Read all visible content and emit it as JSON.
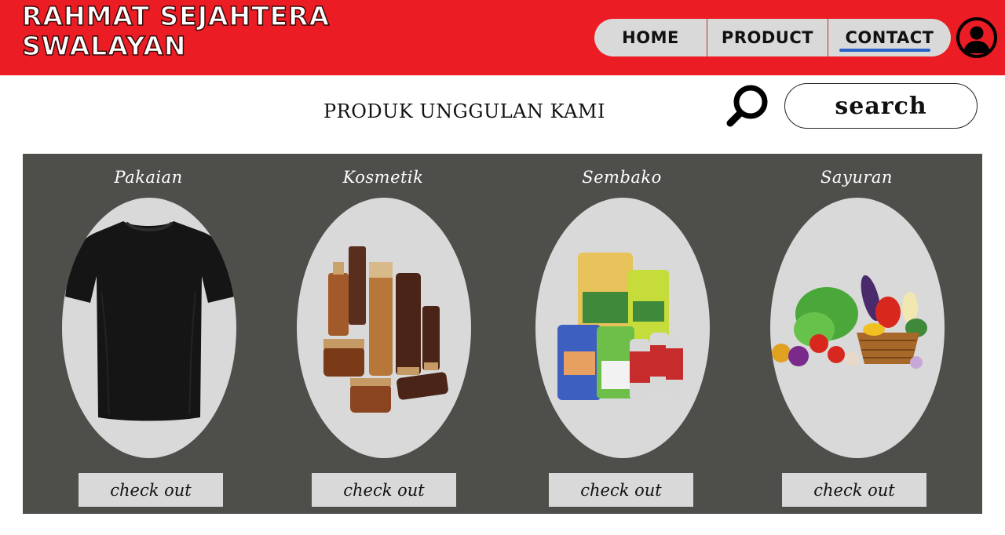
{
  "brand": {
    "line1": "RAHMAT SEJAHTERA",
    "line2": "SWALAYAN"
  },
  "nav": {
    "home": "HOME",
    "product": "PRODUCT",
    "contact": "CONTACT",
    "active": "CONTACT"
  },
  "section": {
    "title": "PRODUK UNGGULAN KAMI"
  },
  "search": {
    "label": "search",
    "icon": "search-icon"
  },
  "products": [
    {
      "title": "Pakaian",
      "button": "check out",
      "image": "black-tshirt"
    },
    {
      "title": "Kosmetik",
      "button": "check out",
      "image": "cosmetic-products"
    },
    {
      "title": "Sembako",
      "button": "check out",
      "image": "grocery-staples"
    },
    {
      "title": "Sayuran",
      "button": "check out",
      "image": "vegetable-basket"
    }
  ],
  "colors": {
    "header": "#ec1c24",
    "panel": "#4e4f4b",
    "oval": "#d9d9d9",
    "accent": "#2a62c9"
  }
}
